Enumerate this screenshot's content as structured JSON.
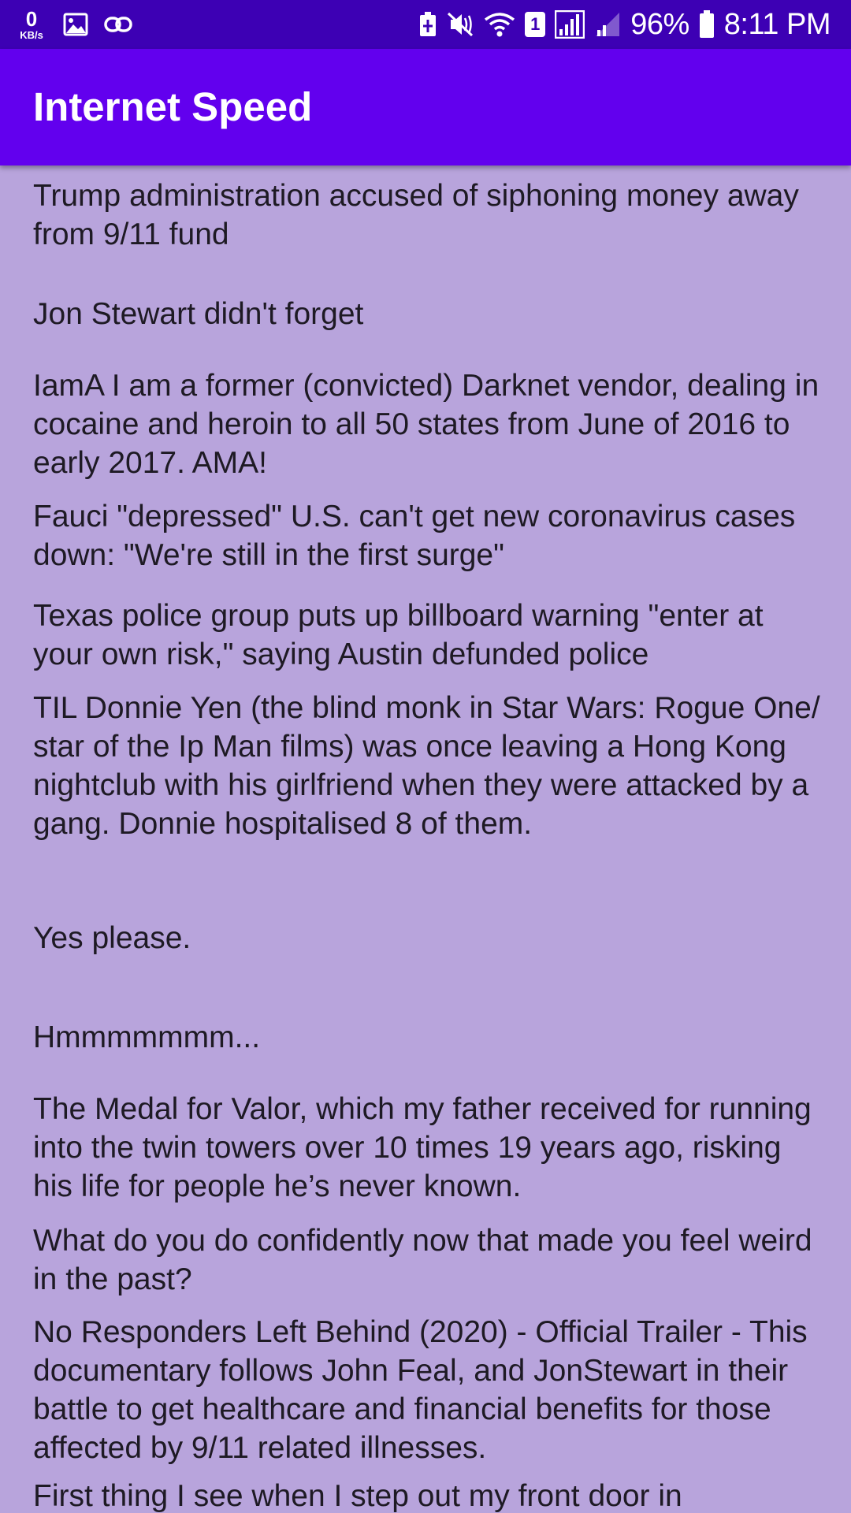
{
  "status_bar": {
    "data_speed_value": "0",
    "data_speed_unit": "KB/s",
    "sim_slot": "1",
    "battery_percent": "96%",
    "time": "8:11 PM",
    "icons": [
      "gallery-icon",
      "link-icon",
      "battery-saver-icon",
      "vibrate-mute-icon",
      "wifi-icon",
      "signal-icon",
      "signal-weak-icon",
      "battery-icon"
    ]
  },
  "app_bar": {
    "title": "Internet Speed",
    "background": "#6200ee"
  },
  "colors": {
    "status_bar": "#3d00b4",
    "content_background": "#b8a4dc",
    "text": "#1e1a24"
  },
  "feed": {
    "items": [
      "Trump administration accused of siphoning money away from 9/11 fund",
      "Jon Stewart didn't forget",
      "IamA I am a former (convicted) Darknet vendor, dealing in cocaine and heroin to all 50 states from June of 2016 to early 2017. AMA!",
      "Fauci \"depressed\" U.S. can't get new coronavirus cases down: \"We're still in the first surge\"",
      "Texas police group puts up billboard warning \"enter at your own risk,\" saying Austin defunded police",
      "TIL Donnie Yen (the blind monk in Star Wars: Rogue One/ star of the Ip Man films) was once leaving a Hong Kong nightclub with his girlfriend when they were attacked by a gang. Donnie hospitalised 8 of them.",
      "Yes please.",
      "Hmmmmmmm...",
      "The Medal for Valor, which my father received for running into the twin towers over 10 times 19 years ago, risking his life for people he’s never known.",
      "What do you do confidently now that made you feel weird in the past?",
      "No Responders Left Behind (2020) - Official Trailer - This documentary follows John Feal, and JonStewart in their battle to get healthcare and financial benefits for those affected by 9/11 related illnesses.",
      "First thing I see when I step out my front door in"
    ]
  }
}
